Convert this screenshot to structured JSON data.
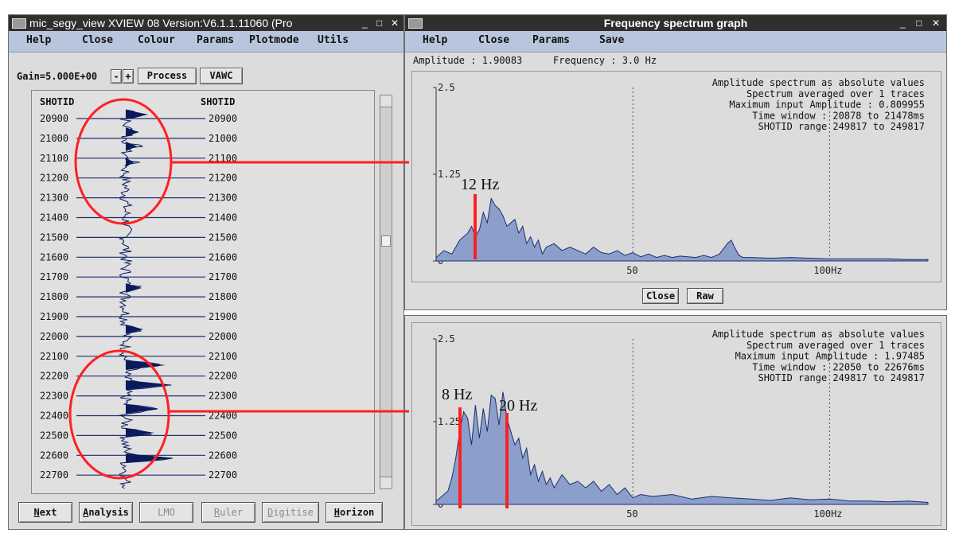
{
  "left_window": {
    "title": "mic_segy_view XVIEW 08   Version:V6.1.1.11060 (Pro",
    "menu": [
      "Help",
      "Close",
      "Colour",
      "Params",
      "Plotmode",
      "Utils"
    ],
    "gain_label": "Gain=5.000E+00",
    "gain_minus": "-",
    "gain_plus": "+",
    "process_label": "Process",
    "vawc_label": "VAWC",
    "axis_header_left": "SHOTID",
    "axis_header_right": "SHOTID",
    "shotids": [
      "20900",
      "21000",
      "21100",
      "21200",
      "21300",
      "21400",
      "21500",
      "21600",
      "21700",
      "21800",
      "21900",
      "22000",
      "22100",
      "22200",
      "22300",
      "22400",
      "22500",
      "22600",
      "22700"
    ],
    "bottom_buttons": [
      {
        "label": "Next",
        "enabled": true
      },
      {
        "label": "Analysis",
        "enabled": true
      },
      {
        "label": "LMO",
        "enabled": false
      },
      {
        "label": "Ruler",
        "enabled": false
      },
      {
        "label": "Digitise",
        "enabled": false
      },
      {
        "label": "Horizon",
        "enabled": true
      }
    ],
    "window_controls": [
      "_",
      "□",
      "✕"
    ]
  },
  "right_window": {
    "title": "Frequency spectrum graph",
    "menu": [
      "Help",
      "Close",
      "Params",
      "Save"
    ],
    "status_amplitude": "Amplitude : 1.90083",
    "status_frequency": "Frequency : 3.0 Hz",
    "close_label": "Close",
    "raw_label": "Raw",
    "window_controls": [
      "_",
      "□",
      "✕"
    ]
  },
  "colors": {
    "spectrum_fill": "#8c9fcb",
    "spectrum_line": "#1a2e6e",
    "annotation_red": "#ff2020",
    "menu_bg": "#b7c6dd",
    "title_bg": "#2f2f2f"
  },
  "annotations": {
    "top_marker": "12 Hz",
    "bottom_marker_left": "8 Hz",
    "bottom_marker_right": "20 Hz"
  },
  "chart_data": [
    {
      "type": "area",
      "ylim": [
        0,
        2.5
      ],
      "xlim": [
        0,
        125
      ],
      "x_ticks": [
        "50",
        "100Hz"
      ],
      "y_ticks": [
        "2.5",
        "1.25",
        "0"
      ],
      "info_lines": [
        "Amplitude spectrum as absolute values",
        "Spectrum averaged over 1 traces",
        "Maximum input Amplitude : 0.809955",
        "Time window : 20878 to 21478ms",
        "SHOTID range 249817 to 249817"
      ],
      "x": [
        0,
        2,
        4,
        6,
        8,
        9,
        10,
        11,
        12,
        13,
        14,
        15,
        16,
        17,
        18,
        19,
        20,
        21,
        22,
        23,
        24,
        25,
        26,
        27,
        28,
        30,
        32,
        34,
        36,
        38,
        40,
        42,
        44,
        46,
        48,
        50,
        52,
        54,
        56,
        58,
        60,
        62,
        64,
        66,
        68,
        70,
        72,
        74,
        75,
        76,
        77,
        78,
        80,
        85,
        90,
        95,
        100,
        105,
        110,
        115,
        120,
        125
      ],
      "y": [
        0.05,
        0.15,
        0.1,
        0.3,
        0.4,
        0.5,
        0.35,
        0.45,
        0.7,
        0.55,
        0.9,
        0.8,
        0.75,
        0.65,
        0.5,
        0.55,
        0.6,
        0.4,
        0.5,
        0.25,
        0.35,
        0.2,
        0.3,
        0.1,
        0.2,
        0.25,
        0.15,
        0.2,
        0.15,
        0.1,
        0.2,
        0.12,
        0.1,
        0.15,
        0.08,
        0.12,
        0.06,
        0.1,
        0.05,
        0.08,
        0.05,
        0.07,
        0.06,
        0.05,
        0.08,
        0.05,
        0.1,
        0.25,
        0.3,
        0.18,
        0.08,
        0.05,
        0.05,
        0.04,
        0.05,
        0.04,
        0.03,
        0.03,
        0.03,
        0.03,
        0.02,
        0.02
      ]
    },
    {
      "type": "area",
      "ylim": [
        0,
        2.5
      ],
      "xlim": [
        0,
        125
      ],
      "x_ticks": [
        "50",
        "100Hz"
      ],
      "y_ticks": [
        "2.5",
        "1.25",
        "0"
      ],
      "info_lines": [
        "Amplitude spectrum as absolute values",
        "Spectrum averaged over 1 traces",
        "Maximum input Amplitude : 1.97485",
        "Time window : 22050 to 22676ms",
        "SHOTID range 249817 to 249817"
      ],
      "x": [
        0,
        1,
        2,
        3,
        4,
        5,
        6,
        7,
        8,
        9,
        10,
        11,
        12,
        13,
        14,
        15,
        16,
        17,
        18,
        19,
        20,
        21,
        22,
        23,
        24,
        25,
        26,
        27,
        28,
        29,
        30,
        32,
        34,
        36,
        38,
        40,
        42,
        44,
        46,
        48,
        50,
        52,
        55,
        60,
        65,
        70,
        75,
        80,
        85,
        90,
        95,
        100,
        105,
        110,
        115,
        120,
        125
      ],
      "y": [
        0.05,
        0.1,
        0.15,
        0.2,
        0.4,
        0.7,
        1.1,
        1.4,
        1.3,
        0.9,
        1.5,
        1.0,
        1.45,
        1.1,
        1.65,
        1.6,
        1.2,
        1.7,
        1.3,
        1.1,
        0.9,
        1.0,
        0.7,
        0.85,
        0.45,
        0.6,
        0.35,
        0.5,
        0.3,
        0.4,
        0.25,
        0.45,
        0.3,
        0.35,
        0.25,
        0.35,
        0.2,
        0.3,
        0.15,
        0.25,
        0.1,
        0.15,
        0.12,
        0.15,
        0.08,
        0.12,
        0.1,
        0.08,
        0.06,
        0.1,
        0.07,
        0.08,
        0.05,
        0.05,
        0.04,
        0.05,
        0.03
      ]
    }
  ]
}
